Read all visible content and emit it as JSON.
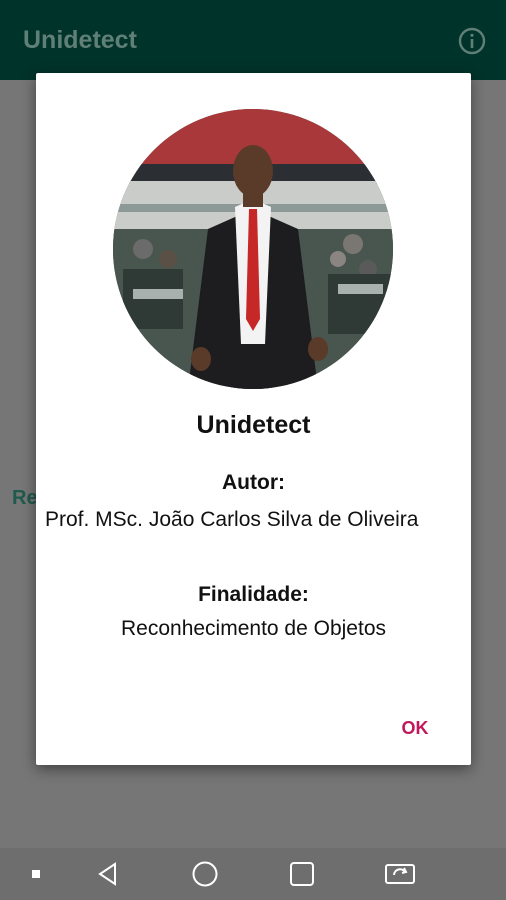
{
  "app_bar": {
    "title": "Unidetect",
    "info_icon": "info-icon"
  },
  "background": {
    "partial_text": "Re"
  },
  "dialog": {
    "image_description_icon": "author-photo",
    "title": "Unidetect",
    "author_label": "Autor:",
    "author_value": "Prof. MSc. João Carlos Silva de Oliveira",
    "purpose_label": "Finalidade:",
    "purpose_value": "Reconhecimento de Objetos",
    "ok_label": "OK",
    "ok_color": "#c2185b"
  },
  "navigation_bar": {
    "items": [
      "dot-icon",
      "back-icon",
      "home-icon",
      "recents-icon",
      "screen-rotate-icon"
    ]
  },
  "colors": {
    "app_bar": "#00332a",
    "scrim": "#767676",
    "accent": "#c2185b"
  }
}
